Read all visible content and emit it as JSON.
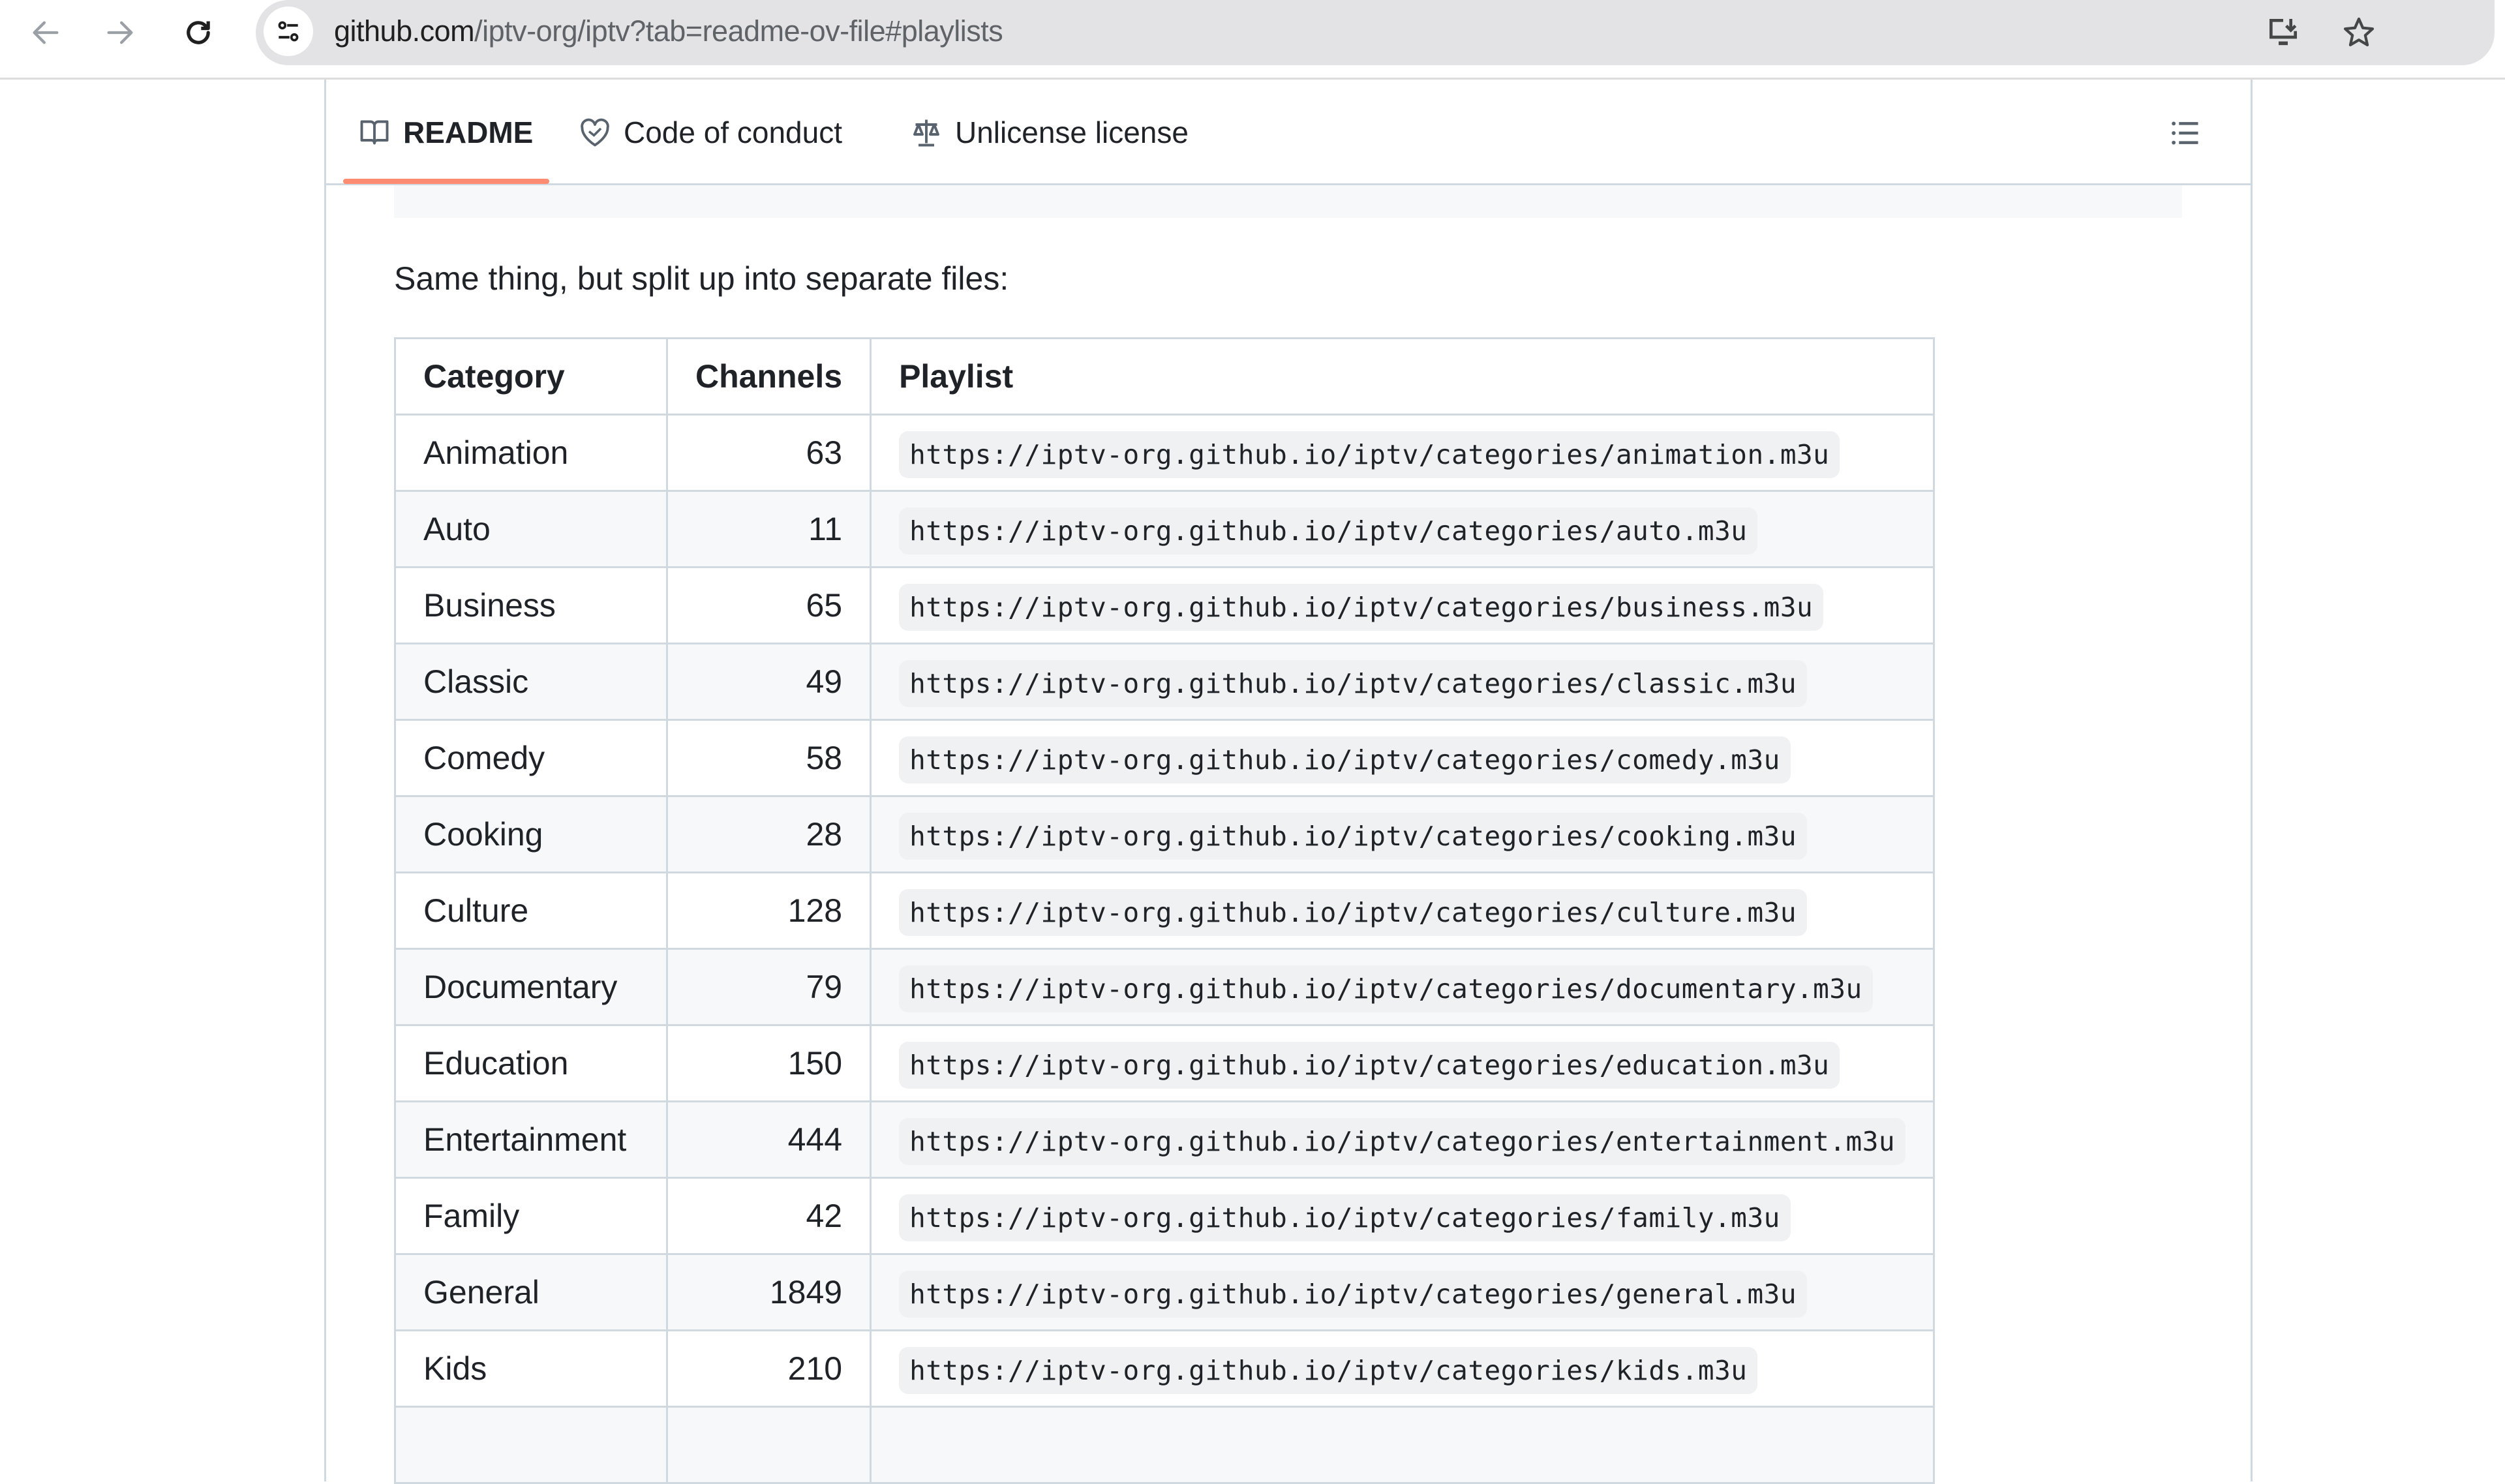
{
  "browser": {
    "url_host": "github.com",
    "url_path": "/iptv-org/iptv?tab=readme-ov-file#playlists",
    "icons": {
      "back": "arrow-left-icon",
      "forward": "arrow-right-icon",
      "reload": "reload-icon",
      "site_info": "tune-icon",
      "install": "install-app-icon",
      "bookmark": "star-icon"
    }
  },
  "tabs": [
    {
      "label": "README",
      "icon": "book-icon",
      "active": true
    },
    {
      "label": "Code of conduct",
      "icon": "code-of-conduct-icon",
      "active": false
    },
    {
      "label": "Unlicense license",
      "icon": "law-icon",
      "active": false
    }
  ],
  "toc_icon": "list-unordered-icon",
  "accent_color": "#fd8c73",
  "intro_text": "Same thing, but split up into separate files:",
  "table": {
    "headers": [
      "Category",
      "Channels",
      "Playlist"
    ],
    "rows": [
      {
        "category": "Animation",
        "channels": "63",
        "playlist": "https://iptv-org.github.io/iptv/categories/animation.m3u"
      },
      {
        "category": "Auto",
        "channels": "11",
        "playlist": "https://iptv-org.github.io/iptv/categories/auto.m3u"
      },
      {
        "category": "Business",
        "channels": "65",
        "playlist": "https://iptv-org.github.io/iptv/categories/business.m3u"
      },
      {
        "category": "Classic",
        "channels": "49",
        "playlist": "https://iptv-org.github.io/iptv/categories/classic.m3u"
      },
      {
        "category": "Comedy",
        "channels": "58",
        "playlist": "https://iptv-org.github.io/iptv/categories/comedy.m3u"
      },
      {
        "category": "Cooking",
        "channels": "28",
        "playlist": "https://iptv-org.github.io/iptv/categories/cooking.m3u"
      },
      {
        "category": "Culture",
        "channels": "128",
        "playlist": "https://iptv-org.github.io/iptv/categories/culture.m3u"
      },
      {
        "category": "Documentary",
        "channels": "79",
        "playlist": "https://iptv-org.github.io/iptv/categories/documentary.m3u"
      },
      {
        "category": "Education",
        "channels": "150",
        "playlist": "https://iptv-org.github.io/iptv/categories/education.m3u"
      },
      {
        "category": "Entertainment",
        "channels": "444",
        "playlist": "https://iptv-org.github.io/iptv/categories/entertainment.m3u"
      },
      {
        "category": "Family",
        "channels": "42",
        "playlist": "https://iptv-org.github.io/iptv/categories/family.m3u"
      },
      {
        "category": "General",
        "channels": "1849",
        "playlist": "https://iptv-org.github.io/iptv/categories/general.m3u"
      },
      {
        "category": "Kids",
        "channels": "210",
        "playlist": "https://iptv-org.github.io/iptv/categories/kids.m3u"
      },
      {
        "category": "",
        "channels": "",
        "playlist": ""
      }
    ]
  }
}
